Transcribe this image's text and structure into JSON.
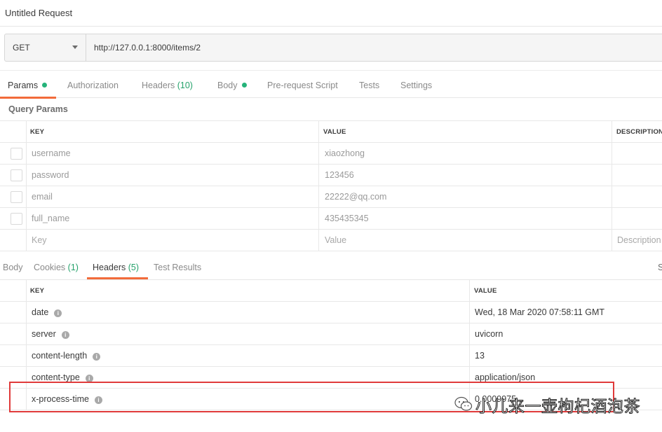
{
  "window": {
    "title": "Untitled Request"
  },
  "request": {
    "method": "GET",
    "url": "http://127.0.0.1:8000/items/2"
  },
  "request_tabs": {
    "params": "Params",
    "authorization": "Authorization",
    "headers": "Headers",
    "headers_count": "(10)",
    "body": "Body",
    "pre_request": "Pre-request Script",
    "tests": "Tests",
    "settings": "Settings"
  },
  "query_params": {
    "title": "Query Params",
    "columns": {
      "key": "KEY",
      "value": "VALUE",
      "description": "DESCRIPTION"
    },
    "rows": [
      {
        "key": "username",
        "value": "xiaozhong"
      },
      {
        "key": "password",
        "value": "123456"
      },
      {
        "key": "email",
        "value": "22222@qq.com"
      },
      {
        "key": "full_name",
        "value": "435435345"
      }
    ],
    "placeholders": {
      "key": "Key",
      "value": "Value",
      "description": "Description"
    }
  },
  "response_tabs": {
    "body": "Body",
    "cookies": "Cookies",
    "cookies_count": "(1)",
    "headers": "Headers",
    "headers_count": "(5)",
    "test_results": "Test Results",
    "edge": "S"
  },
  "response_headers": {
    "columns": {
      "key": "KEY",
      "value": "VALUE"
    },
    "rows": [
      {
        "key": "date",
        "value": "Wed, 18 Mar 2020 07:58:11 GMT"
      },
      {
        "key": "server",
        "value": "uvicorn"
      },
      {
        "key": "content-length",
        "value": "13"
      },
      {
        "key": "content-type",
        "value": "application/json"
      },
      {
        "key": "x-process-time",
        "value": "0.0009975..."
      }
    ],
    "info_glyph": "i"
  },
  "watermark": {
    "text": "小儿来一壶枸杞酒泡茶"
  },
  "colors": {
    "accent": "#f26b3a",
    "status_green": "#25b37a",
    "highlight": "#e03a3a"
  }
}
